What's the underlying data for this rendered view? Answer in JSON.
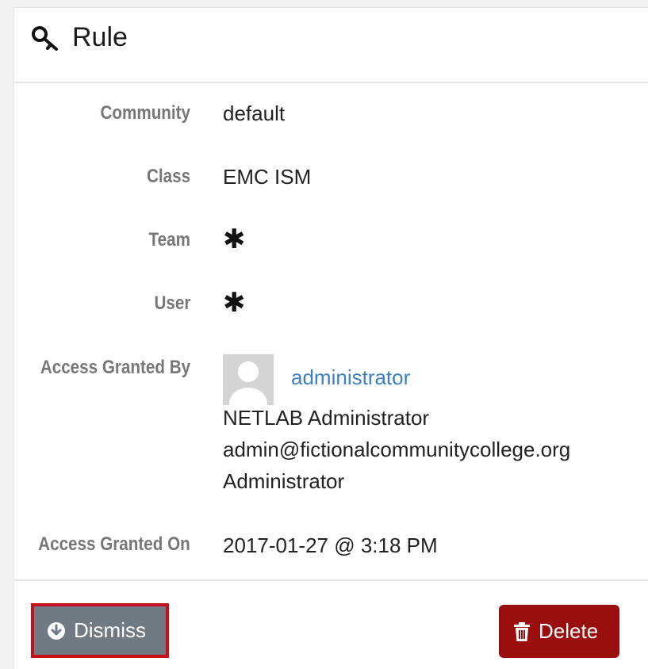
{
  "header": {
    "icon": "key-icon",
    "title": "Rule"
  },
  "details": {
    "community": {
      "label": "Community",
      "value": "default"
    },
    "class": {
      "label": "Class",
      "value": "EMC ISM"
    },
    "team": {
      "label": "Team",
      "value": "✱"
    },
    "user": {
      "label": "User",
      "value": "✱"
    },
    "access_granted_by": {
      "label": "Access Granted By",
      "avatar_icon": "user-avatar-placeholder",
      "username": "administrator",
      "full_name": "NETLAB Administrator",
      "email": "admin@fictionalcommunitycollege.org",
      "role": "Administrator"
    },
    "access_granted_on": {
      "label": "Access Granted On",
      "value": "2017-01-27 @ 3:18 PM"
    }
  },
  "footer": {
    "dismiss_label": "Dismiss",
    "dismiss_icon": "arrow-circle-down-icon",
    "delete_label": "Delete",
    "delete_icon": "trash-icon"
  },
  "colors": {
    "link": "#3a7fc4",
    "dismiss_bg": "#707a83",
    "dismiss_highlight_border": "#c8101c",
    "delete_bg": "#9b0e0e",
    "label_text": "#777777"
  }
}
